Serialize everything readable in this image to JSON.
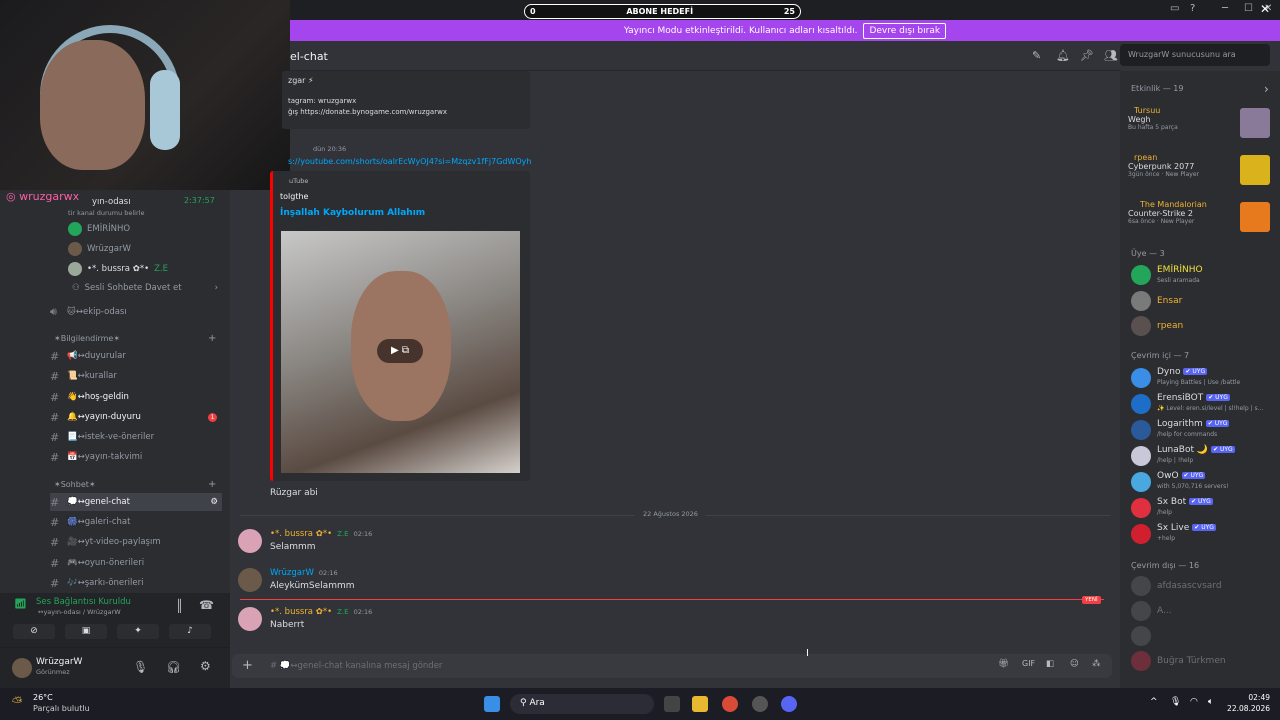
{
  "goal": {
    "left": "0",
    "label": "ABONE HEDEFİ",
    "right": "25"
  },
  "banner": {
    "text": "Yayıncı Modu etkinleştirildi. Kullanıcı adları kısaltıldı.",
    "button": "Devre dışı bırak"
  },
  "channel": {
    "title": "el-chat",
    "search_placeholder": "WruzgarW sunucusunu ara"
  },
  "overlay": {
    "handle": "wruzgarwx",
    "timer": "2:37:57"
  },
  "sidebar": {
    "voice_channel": "yın-odası",
    "status_hint": "tir kanal durumu belirle",
    "voice_members": [
      "EMİRİNHO",
      "WrüzgarW",
      "•*.  bussra ✿*•"
    ],
    "voice_member_tag": "Z.E",
    "invite": "Sesli Sohbete Davet et",
    "ekip": "🐱↔ekip-odası",
    "cat1": "✶Bilgilendirme✶",
    "info_channels": [
      "📢↔duyurular",
      "📜↔kurallar",
      "👋↔hoş-geldin",
      "🔔↔yayın-duyuru",
      "📃↔istek-ve-öneriler",
      "📅↔yayın-takvimi"
    ],
    "unread_badge": "1",
    "cat2": "✶Sohbet✶",
    "chat_channels": [
      "💭↔genel-chat",
      "🎆↔galeri-chat",
      "🎥↔yt-video-paylaşım",
      "🎮↔oyun-önerileri",
      "🎶↔şarkı-önerileri"
    ]
  },
  "voice": {
    "title": "Ses Bağlantısı Kuruldu",
    "sub": "↔yayın-odası / WrüzgarW"
  },
  "user": {
    "name": "WrüzgarW",
    "status": "Görünmez"
  },
  "chat": {
    "embed1_title": "zgar ⚡",
    "embed1_line1": "tagram: wruzgarwx",
    "embed1_line2": "ğış https://donate.bynogame.com/wruzgarwx",
    "msg2_time": "dün 20:36",
    "msg2_link": "s://youtube.com/shorts/oalrEcWyOJ4?si=Mzqzv1fFj7GdWOyh",
    "yt_label": "uTube",
    "yt_channel": "tolgthe",
    "yt_title": "İnşallah Kaybolurum Allahım",
    "after_video": "Rüzgar abi",
    "date_divider": "22 Ağustos 2026",
    "messages": [
      {
        "author": "•*.  bussra ✿*•",
        "tag": "Z.E",
        "time": "02:16",
        "text": "Selammm"
      },
      {
        "author": "WrüzgarW",
        "tag": "",
        "time": "02:16",
        "text": "AleykümSelammm"
      },
      {
        "author": "•*.  bussra ✿*•",
        "tag": "Z.E",
        "time": "02:16",
        "text": "Naberrt"
      }
    ],
    "new_label": "YENİ",
    "composer_placeholder": "# 💭↔genel-chat kanalına mesaj gönder"
  },
  "members": {
    "activity_head": "Etkinlik — 19",
    "activities": [
      {
        "name": "Tursuu",
        "game": "Wegh",
        "sub": "Bu hafta 5 parça",
        "color": "#8a7a9a"
      },
      {
        "name": "rpean",
        "game": "Cyberpunk 2077",
        "sub": "3gün önce · New Player",
        "color": "#d9b21c"
      },
      {
        "name": "The Mandalorian",
        "game": "Counter-Strike 2",
        "sub": "6sa önce · New Player",
        "color": "#e87a1e"
      }
    ],
    "uye_head": "Üye — 3",
    "uye": [
      {
        "name": "EMİRİNHO",
        "sub": "Sesli aramada",
        "color": "#f0e040"
      },
      {
        "name": "Ensar",
        "sub": "",
        "color": "#f0b232"
      },
      {
        "name": "rpean",
        "sub": "",
        "color": "#f0b232"
      }
    ],
    "online_head": "Çevrim içi — 7",
    "online": [
      {
        "name": "Dyno",
        "sub": "Playing Battles | Use /battle"
      },
      {
        "name": "ErensiBOT",
        "sub": "✨ Level: eren.si/level | sl!help | s..."
      },
      {
        "name": "Logarithm",
        "sub": "/help for commands"
      },
      {
        "name": "LunaBot 🌙",
        "sub": "/help | !help"
      },
      {
        "name": "OwO",
        "sub": "with 5,070,716 servers!"
      },
      {
        "name": "Sx Bot",
        "sub": "/help"
      },
      {
        "name": "Sx Live",
        "sub": "+help"
      }
    ],
    "bot_tag": "✔ UYG",
    "offline_head": "Çevrim dışı — 16",
    "offline": [
      "afdasascvsard",
      "A...",
      "",
      "Buğra Türkmen"
    ]
  },
  "taskbar": {
    "temp": "26°C",
    "weather": "Parçalı bulutlu",
    "search": "Ara",
    "time": "02:49",
    "date": "22.08.2026"
  }
}
